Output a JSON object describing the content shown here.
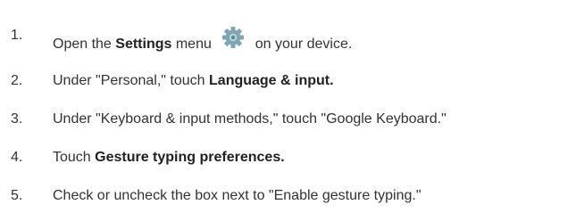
{
  "steps": [
    {
      "number": "1.",
      "parts": [
        "Open the ",
        "Settings",
        " menu ",
        "",
        " on your device."
      ],
      "icon": "settings-gear-icon"
    },
    {
      "number": "2.",
      "parts": [
        "Under \"Personal,\" touch ",
        "Language & input."
      ]
    },
    {
      "number": "3.",
      "parts": [
        "Under \"Keyboard & input methods,\" touch \"Google Keyboard.\""
      ]
    },
    {
      "number": "4.",
      "parts": [
        "Touch ",
        "Gesture typing preferences."
      ]
    },
    {
      "number": "5.",
      "parts": [
        "Check or uncheck the box next to \"Enable gesture typing.\""
      ]
    }
  ],
  "colors": {
    "text": "#333333",
    "gear_fill": "#7fa7b3",
    "gear_center": "#bcd3da"
  }
}
